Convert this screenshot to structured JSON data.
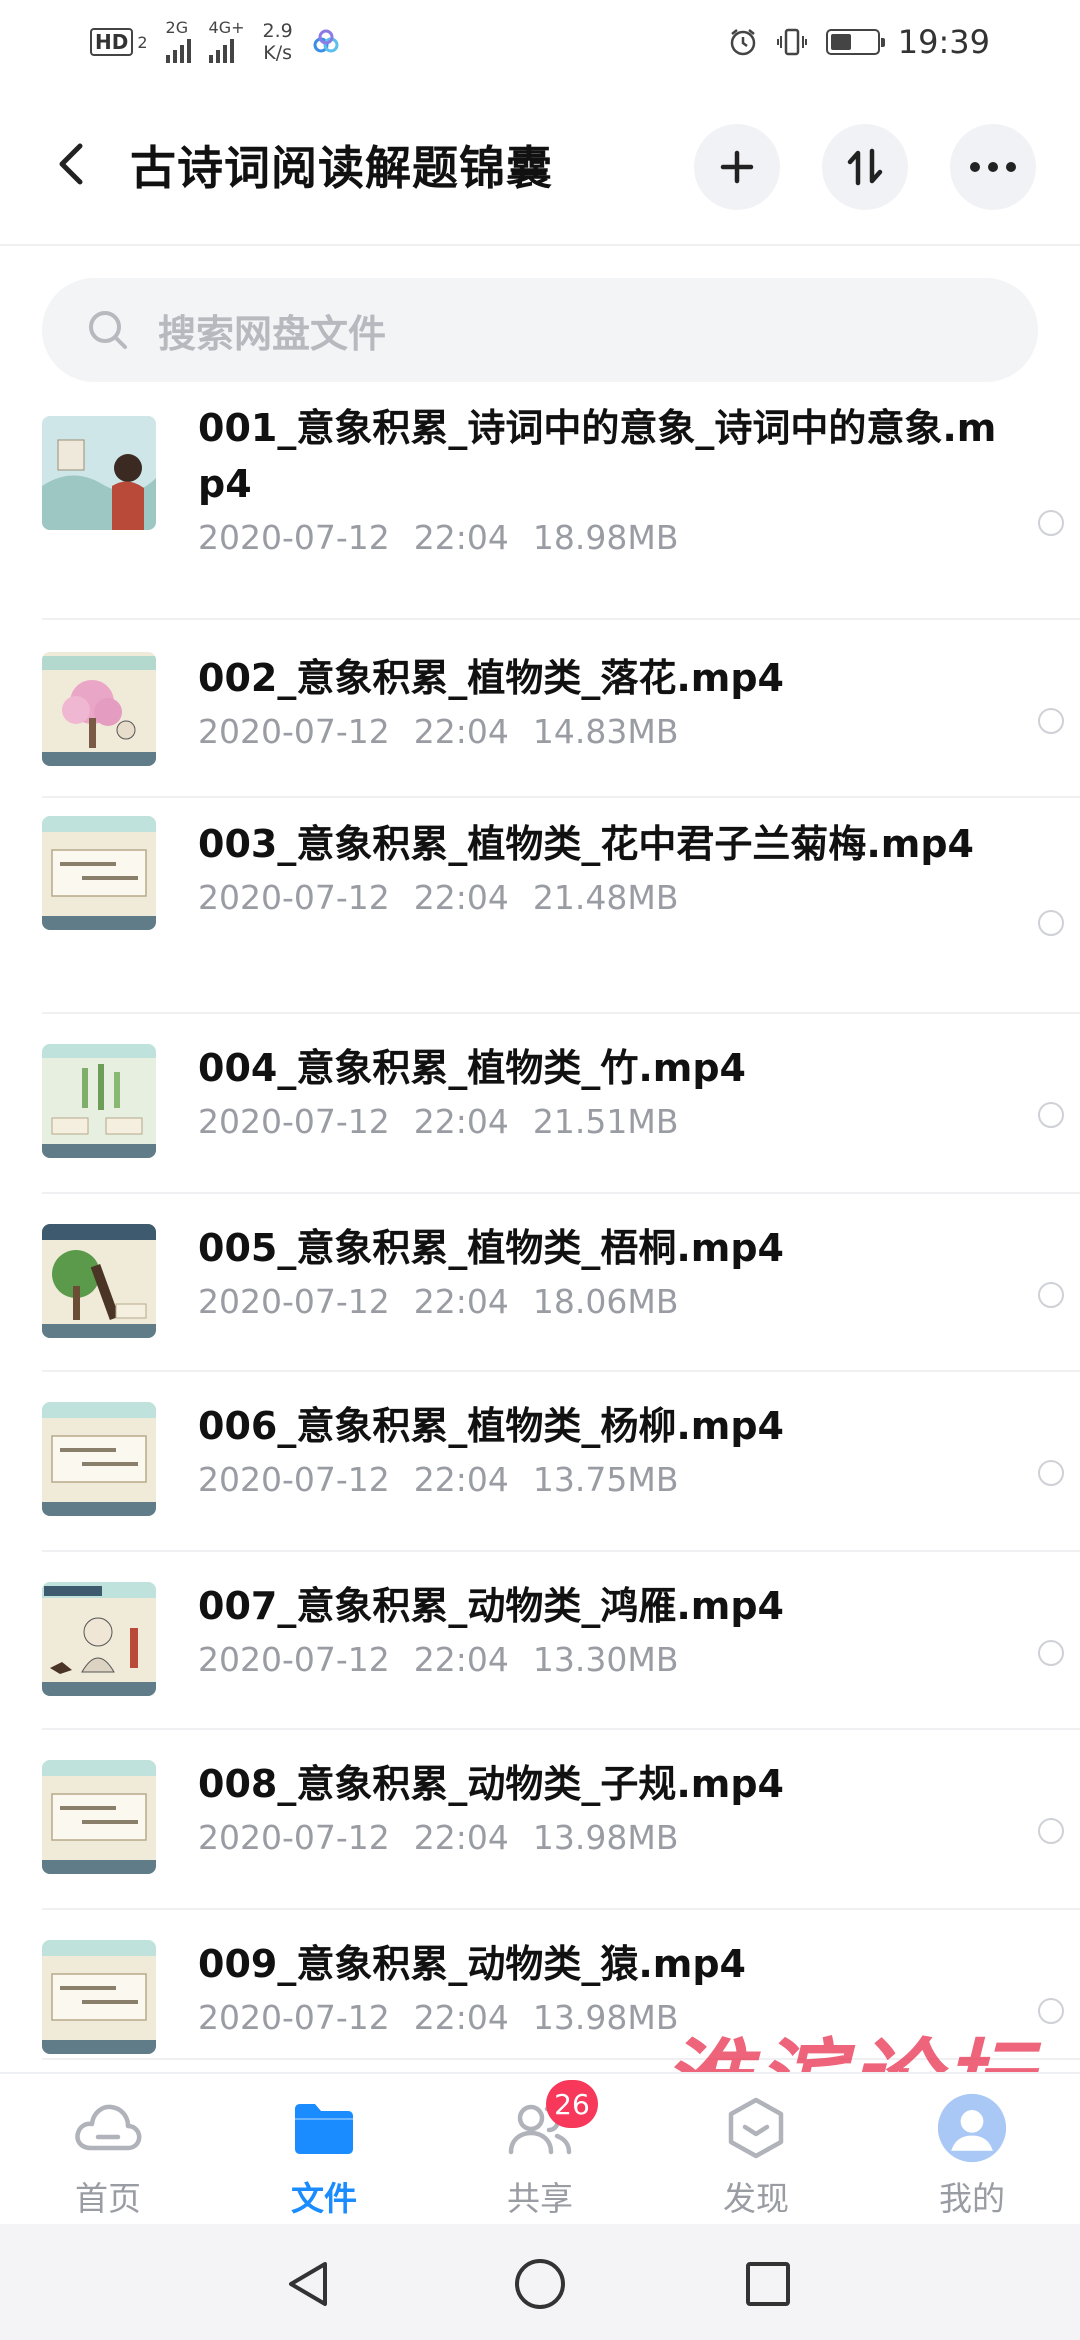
{
  "status_bar": {
    "hd": "HD",
    "hd_sub": "2",
    "net1": "2G",
    "net2": "4G+",
    "speed_value": "2.9",
    "speed_unit": "K/s",
    "time": "19:39",
    "battery_level": 0.45
  },
  "header": {
    "title": "古诗词阅读解题锦囊"
  },
  "search": {
    "placeholder": "搜索网盘文件"
  },
  "files": [
    {
      "name": "001_意象积累_诗词中的意象_诗词中的意象.mp4",
      "date": "2020-07-12",
      "time": "22:04",
      "size": "18.98MB",
      "thumb": "landscape-girl"
    },
    {
      "name": "002_意象积累_植物类_落花.mp4",
      "date": "2020-07-12",
      "time": "22:04",
      "size": "14.83MB",
      "thumb": "cherry-tree"
    },
    {
      "name": "003_意象积累_植物类_花中君子兰菊梅.mp4",
      "date": "2020-07-12",
      "time": "22:04",
      "size": "21.48MB",
      "thumb": "text-card"
    },
    {
      "name": "004_意象积累_植物类_竹.mp4",
      "date": "2020-07-12",
      "time": "22:04",
      "size": "21.51MB",
      "thumb": "bamboo"
    },
    {
      "name": "005_意象积累_植物类_梧桐.mp4",
      "date": "2020-07-12",
      "time": "22:04",
      "size": "18.06MB",
      "thumb": "tree"
    },
    {
      "name": "006_意象积累_植物类_杨柳.mp4",
      "date": "2020-07-12",
      "time": "22:04",
      "size": "13.75MB",
      "thumb": "text-card"
    },
    {
      "name": "007_意象积累_动物类_鸿雁.mp4",
      "date": "2020-07-12",
      "time": "22:04",
      "size": "13.30MB",
      "thumb": "character"
    },
    {
      "name": "008_意象积累_动物类_子规.mp4",
      "date": "2020-07-12",
      "time": "22:04",
      "size": "13.98MB",
      "thumb": "text-card"
    },
    {
      "name": "009_意象积累_动物类_猿.mp4",
      "date": "2020-07-12",
      "time": "22:04",
      "size": "13.98MB",
      "thumb": "text-card"
    }
  ],
  "bottom_nav": [
    {
      "label": "首页",
      "icon": "cloud-icon",
      "active": false
    },
    {
      "label": "文件",
      "icon": "folder-icon",
      "active": true
    },
    {
      "label": "共享",
      "icon": "people-icon",
      "active": false,
      "badge": "26"
    },
    {
      "label": "发现",
      "icon": "discover-icon",
      "active": false
    },
    {
      "label": "我的",
      "icon": "avatar-icon",
      "active": false
    }
  ],
  "watermark": "淮滨论坛",
  "colors": {
    "accent": "#1a8cff",
    "badge": "#f7385a",
    "meta_text": "#9a9ca3"
  }
}
